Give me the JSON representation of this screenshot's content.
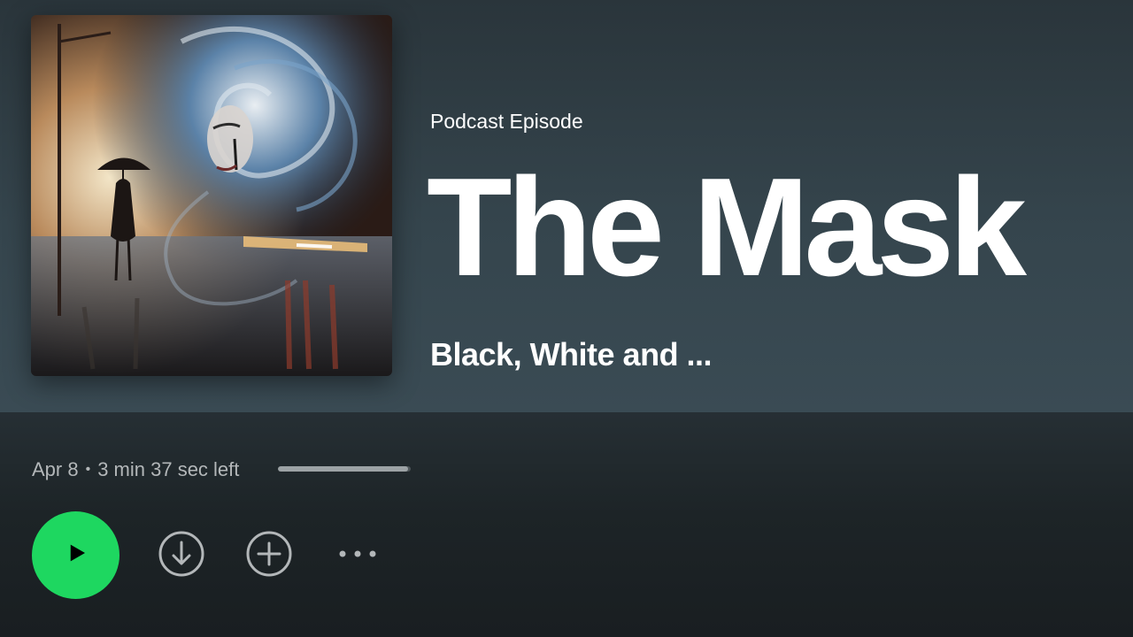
{
  "episode": {
    "type_label": "Podcast Episode",
    "title": "The Mask",
    "show_name": "Black, White and ..."
  },
  "meta": {
    "date": "Apr 8",
    "separator": "•",
    "time_left": "3 min 37 sec left",
    "progress_fraction": 0.98
  },
  "controls": {
    "play_icon": "play-icon",
    "download_icon": "download-circle-icon",
    "add_icon": "add-circle-icon",
    "more_icon": "more-horizontal-icon"
  },
  "colors": {
    "accent": "#1ed760",
    "hero_background": "#35454d",
    "text_secondary": "#b3b7b9"
  }
}
